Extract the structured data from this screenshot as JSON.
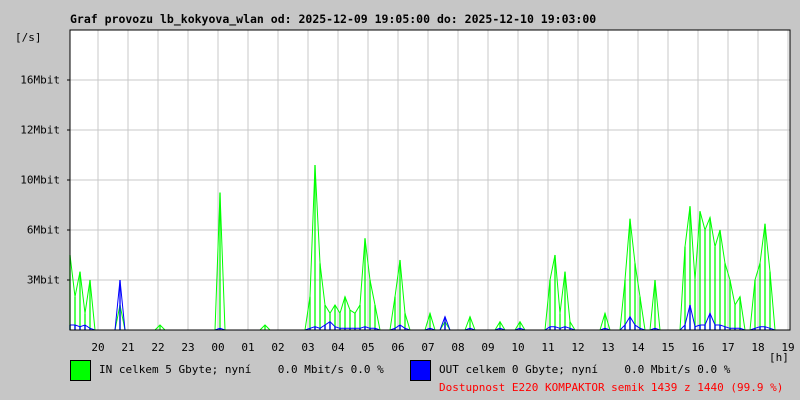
{
  "title": "Graf provozu lb_kokyova_wlan od: 2025-12-09 19:05:00 do: 2025-12-10 19:03:00",
  "colors": {
    "in": "#00ff00",
    "out": "#0000ff",
    "availability": "#ff0000",
    "grid": "#c8c8c8"
  },
  "chart_data": {
    "type": "area",
    "title": "Graf provozu lb_kokyova_wlan od: 2025-12-09 19:05:00 do: 2025-12-10 19:03:00",
    "ylabel": "[/s]",
    "xlabel": "[h]",
    "y_ticks": [
      "3Mbit",
      "6Mbit",
      "10Mbit",
      "12Mbit",
      "16Mbit"
    ],
    "y_tick_values": [
      3,
      6,
      10,
      12,
      16
    ],
    "x_ticks": [
      "20",
      "21",
      "22",
      "23",
      "00",
      "01",
      "02",
      "03",
      "04",
      "05",
      "06",
      "07",
      "08",
      "09",
      "10",
      "11",
      "12",
      "13",
      "14",
      "15",
      "16",
      "17",
      "18",
      "19"
    ],
    "sample_minutes": 10,
    "start": "2025-12-09 19:05",
    "series": [
      {
        "name": "IN",
        "unit": "Mbit/s",
        "values": [
          4.5,
          2,
          3.5,
          1,
          3,
          0,
          0,
          0,
          0,
          0,
          1.5,
          0,
          0,
          0,
          0,
          0,
          0,
          0,
          0.3,
          0,
          0,
          0,
          0,
          0,
          0,
          0,
          0,
          0,
          0,
          0,
          9,
          0,
          0,
          0,
          0,
          0,
          0,
          0,
          0,
          0.3,
          0,
          0,
          0,
          0,
          0,
          0,
          0,
          0,
          2,
          10.6,
          4,
          1.5,
          1,
          1.5,
          1,
          2,
          1.2,
          1,
          1.5,
          5.5,
          3,
          1.5,
          0,
          0,
          0,
          2,
          4.2,
          1,
          0,
          0,
          0,
          0,
          1,
          0,
          0,
          0.5,
          0,
          0,
          0,
          0,
          0.8,
          0,
          0,
          0,
          0,
          0,
          0.5,
          0,
          0,
          0,
          0.5,
          0,
          0,
          0,
          0,
          0,
          3,
          4.5,
          1,
          3.5,
          0.5,
          0,
          0,
          0,
          0,
          0,
          0,
          1,
          0,
          0,
          0,
          3,
          6.9,
          4,
          2,
          0,
          0,
          3,
          0,
          0,
          0,
          0,
          0,
          5,
          7.9,
          3,
          7.5,
          6,
          7,
          5,
          6,
          4,
          3,
          1.5,
          2,
          0,
          0,
          3,
          4,
          6.5,
          3.5,
          0,
          0,
          0,
          0
        ]
      },
      {
        "name": "OUT",
        "unit": "Mbit/s",
        "values": [
          0.3,
          0.3,
          0.2,
          0.3,
          0.1,
          0,
          0,
          0,
          0,
          0,
          3,
          0,
          0,
          0,
          0,
          0,
          0,
          0,
          0,
          0,
          0,
          0,
          0,
          0,
          0,
          0,
          0,
          0,
          0,
          0,
          0.1,
          0,
          0,
          0,
          0,
          0,
          0,
          0,
          0,
          0,
          0,
          0,
          0,
          0,
          0,
          0,
          0,
          0,
          0.1,
          0.2,
          0.1,
          0.3,
          0.5,
          0.2,
          0.1,
          0.1,
          0.1,
          0.1,
          0.1,
          0.2,
          0.1,
          0.1,
          0,
          0,
          0,
          0.1,
          0.3,
          0.1,
          0,
          0,
          0,
          0,
          0.1,
          0,
          0,
          0.8,
          0,
          0,
          0,
          0,
          0.1,
          0,
          0,
          0,
          0,
          0,
          0.1,
          0,
          0,
          0,
          0.1,
          0,
          0,
          0,
          0,
          0,
          0.2,
          0.2,
          0.1,
          0.2,
          0.1,
          0,
          0,
          0,
          0,
          0,
          0,
          0.1,
          0,
          0,
          0,
          0.3,
          0.8,
          0.3,
          0.1,
          0,
          0,
          0.1,
          0,
          0,
          0,
          0,
          0,
          0.3,
          1.5,
          0.2,
          0.3,
          0.3,
          1,
          0.3,
          0.3,
          0.2,
          0.1,
          0.1,
          0.1,
          0,
          0,
          0.1,
          0.2,
          0.2,
          0.1,
          0,
          0,
          0,
          0
        ]
      }
    ]
  },
  "legend": {
    "in": "IN celkem 5 Gbyte; nyní    0.0 Mbit/s 0.0 %",
    "out": "OUT celkem 0 Gbyte; nyní    0.0 Mbit/s 0.0 %",
    "availability": "Dostupnost E220 KOMPAKTOR semik 1439 z 1440 (99.9 %)"
  }
}
